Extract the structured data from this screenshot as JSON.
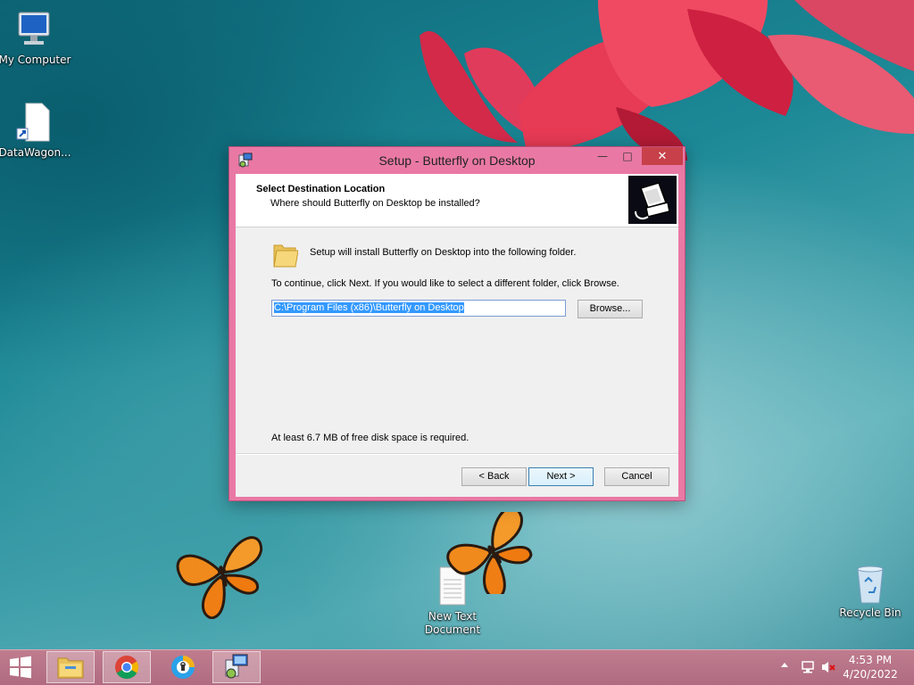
{
  "desktop": {
    "icons": [
      {
        "label": "My Computer"
      },
      {
        "label": "DataWagon..."
      },
      {
        "label": "New Text Document"
      },
      {
        "label": "Recycle Bin"
      }
    ]
  },
  "dialog": {
    "title": "Setup - Butterfly on Desktop",
    "header_title": "Select Destination Location",
    "header_subtitle": "Where should Butterfly on Desktop be installed?",
    "info_text": "Setup will install Butterfly on Desktop into the following folder.",
    "continue_text": "To continue, click Next. If you would like to select a different folder, click Browse.",
    "path_value": "C:\\Program Files (x86)\\Butterfly on Desktop",
    "browse_label": "Browse...",
    "space_text": "At least 6.7 MB of free disk space is required.",
    "back_label": "< Back",
    "next_label": "Next >",
    "cancel_label": "Cancel",
    "minimize_glyph": "—",
    "maximize_glyph": "□",
    "close_glyph": "✕"
  },
  "taskbar": {
    "items": [
      {
        "name": "file-explorer",
        "icon": "folder-icon"
      },
      {
        "name": "chrome",
        "icon": "chrome-icon"
      },
      {
        "name": "browser",
        "icon": "browser-icon"
      },
      {
        "name": "setup",
        "icon": "setup-icon",
        "active": true
      }
    ],
    "clock_time": "4:53 PM",
    "clock_date": "4/20/2022"
  },
  "colors": {
    "accent": "#e979a4",
    "taskbar": "#b8758a",
    "selection": "#3399ff"
  }
}
